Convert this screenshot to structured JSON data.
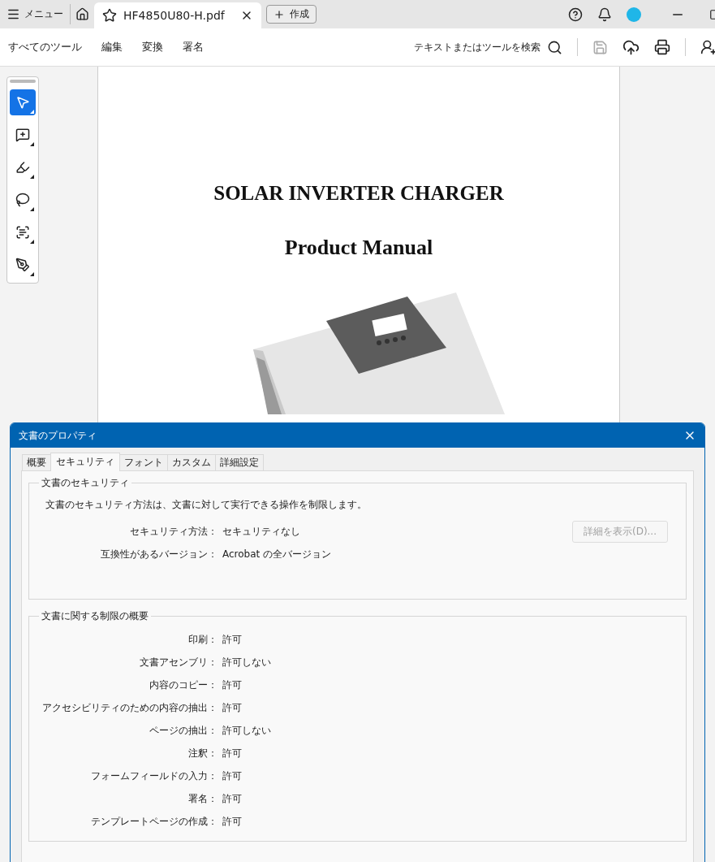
{
  "top_bar": {
    "menu": "メニュー",
    "document_tab": {
      "title": "HF4850U80-H.pdf"
    },
    "create": "作成"
  },
  "toolbar": {
    "menus": [
      "すべてのツール",
      "編集",
      "変換",
      "署名"
    ],
    "search_label": "テキストまたはツールを検索",
    "save_disabled": true
  },
  "tool_panel": {
    "tools": [
      {
        "kind": "select",
        "selected": true
      },
      {
        "kind": "comment",
        "selected": false
      },
      {
        "kind": "highlight",
        "selected": false
      },
      {
        "kind": "lasso",
        "selected": false
      },
      {
        "kind": "text-select",
        "selected": false
      },
      {
        "kind": "sign",
        "selected": false
      }
    ]
  },
  "document": {
    "title": "SOLAR INVERTER CHARGER",
    "subtitle": "Product Manual"
  },
  "dialog": {
    "title": "文書のプロパティ",
    "tabs": [
      {
        "label": "概要",
        "selected": false
      },
      {
        "label": "セキュリティ",
        "selected": true
      },
      {
        "label": "フォント",
        "selected": false
      },
      {
        "label": "カスタム",
        "selected": false
      },
      {
        "label": "詳細設定",
        "selected": false
      }
    ],
    "security_group": {
      "legend": "文書のセキュリティ",
      "description": "文書のセキュリティ方法は、文書に対して実行できる操作を制限します。",
      "rows": [
        {
          "label": "セキュリティ方法：",
          "value": "セキュリティなし"
        },
        {
          "label": "互換性があるバージョン：",
          "value": "Acrobat の全バージョン"
        }
      ],
      "details_button": {
        "label": "詳細を表示(D)...",
        "disabled": true
      }
    },
    "restrictions_group": {
      "legend": "文書に関する制限の概要",
      "rows": [
        {
          "label": "印刷：",
          "value": "許可"
        },
        {
          "label": "文書アセンブリ：",
          "value": "許可しない"
        },
        {
          "label": "内容のコピー：",
          "value": "許可"
        },
        {
          "label": "アクセシビリティのための内容の抽出：",
          "value": "許可"
        },
        {
          "label": "ページの抽出：",
          "value": "許可しない"
        },
        {
          "label": "注釈：",
          "value": "許可"
        },
        {
          "label": "フォームフィールドの入力：",
          "value": "許可"
        },
        {
          "label": "署名：",
          "value": "許可"
        },
        {
          "label": "テンプレートページの作成：",
          "value": "許可"
        }
      ]
    }
  }
}
